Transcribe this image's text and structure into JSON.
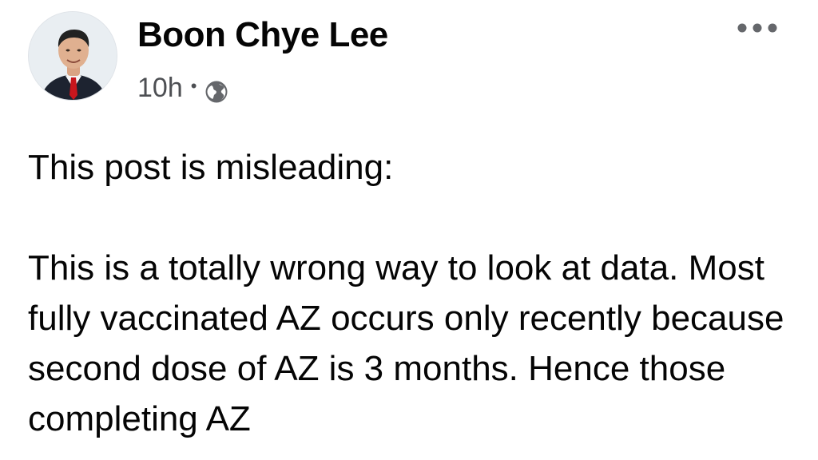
{
  "post": {
    "author": {
      "name": "Boon Chye Lee",
      "avatar_icon": "profile-photo"
    },
    "meta": {
      "timestamp": "10h",
      "separator": "•",
      "privacy_icon": "globe-icon"
    },
    "more_icon": "more-options-icon",
    "body": {
      "paragraph_1": "This post is misleading:",
      "paragraph_2": "This is a totally wrong way to look at data. Most fully vaccinated AZ occurs only recently because second dose of AZ is 3 months. Hence those completing AZ"
    }
  },
  "colors": {
    "text_primary": "#050505",
    "text_secondary": "#4d4f53",
    "background": "#ffffff"
  }
}
